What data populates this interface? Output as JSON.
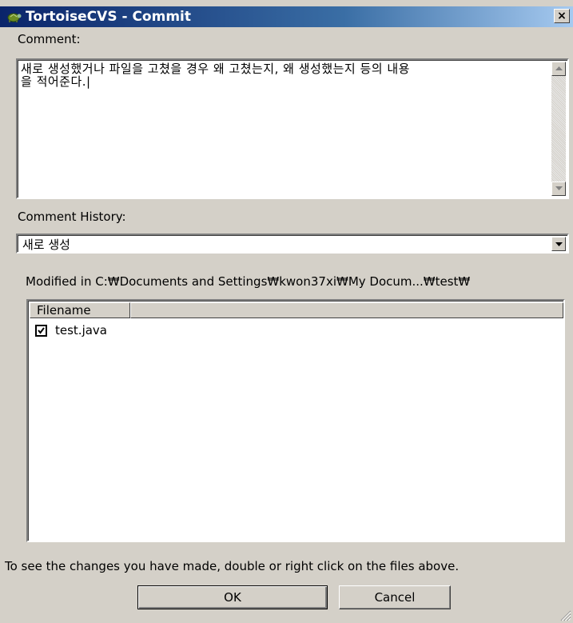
{
  "window": {
    "title": "TortoiseCVS - Commit",
    "close_label": "×",
    "title_icon": "turtle-icon"
  },
  "comment": {
    "label": "Comment:",
    "text": "새로 생성했거나 파일을 고쳤을 경우 왜 고쳤는지, 왜 생성했는지 등의 내용\n을 적어준다.|"
  },
  "history": {
    "label": "Comment History:",
    "selected": "새로 생성"
  },
  "files": {
    "modified_path": "Modified in C:₩Documents and Settings₩kwon37xi₩My Docum...₩test₩",
    "column_header": "Filename",
    "rows": [
      {
        "name": "test.java",
        "checked": true
      }
    ]
  },
  "hint": "To see the changes you have made, double or right click on the files above.",
  "buttons": {
    "ok": "OK",
    "cancel": "Cancel"
  }
}
